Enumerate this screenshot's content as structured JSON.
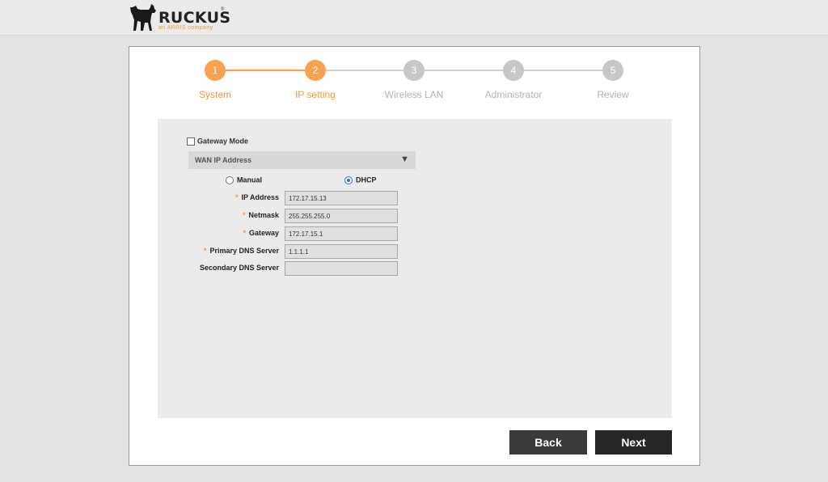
{
  "brand": {
    "name": "RUCKUS",
    "trademark": "®",
    "tagline": "an ARRIS company",
    "accent_color": "#f39a3b"
  },
  "wizard": {
    "steps": [
      {
        "number": "1",
        "label": "System",
        "state": "active"
      },
      {
        "number": "2",
        "label": "IP setting",
        "state": "active"
      },
      {
        "number": "3",
        "label": "Wireless LAN",
        "state": "inactive"
      },
      {
        "number": "4",
        "label": "Administrator",
        "state": "inactive"
      },
      {
        "number": "5",
        "label": "Review",
        "state": "inactive"
      }
    ]
  },
  "form": {
    "gateway_mode_label": "Gateway Mode",
    "gateway_mode_checked": false,
    "wan_select_label": "WAN IP Address",
    "wan_select_arrow": "▼",
    "radio_manual_label": "Manual",
    "radio_dhcp_label": "DHCP",
    "selected_mode": "DHCP",
    "required_marker": "*",
    "fields": [
      {
        "label": "IP Address",
        "value": "172.17.15.13",
        "required": true
      },
      {
        "label": "Netmask",
        "value": "255.255.255.0",
        "required": true
      },
      {
        "label": "Gateway",
        "value": "172.17.15.1",
        "required": true
      },
      {
        "label": "Primary DNS Server",
        "value": "1.1.1.1",
        "required": true
      },
      {
        "label": "Secondary DNS Server",
        "value": "",
        "required": false
      }
    ]
  },
  "buttons": {
    "back_label": "Back",
    "next_label": "Next"
  }
}
